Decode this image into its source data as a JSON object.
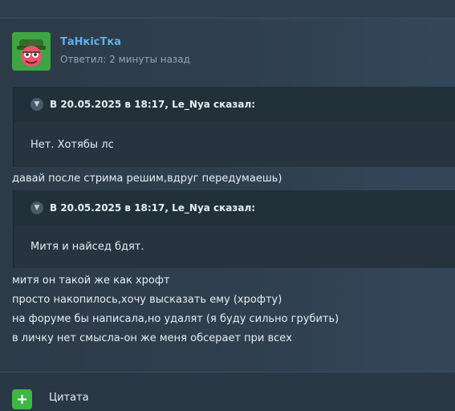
{
  "post": {
    "author": "ТаНкісТка",
    "meta": "Ответил: 2 минуты назад"
  },
  "quotes": [
    {
      "header": "В 20.05.2025 в 18:17, Le_Nya сказал:",
      "body": "Нет. Хотябы лс"
    },
    {
      "header": "В 20.05.2025 в 18:17, Le_Nya сказал:",
      "body": "Митя и найсед бдят."
    }
  ],
  "reply_line": "давай после стрима решим,вдруг передумаешь)",
  "text_lines": [
    "митя он такой же как хрофт",
    "просто накопилось,хочу высказать ему (хрофту)",
    "на форуме бы написала,но удалят (я буду сильно грубить)",
    "в личку нет смысла-он же меня обсерает при всех"
  ],
  "footer": {
    "quote_label": "Цитата"
  },
  "icons": {
    "expand": "chevron-down-icon",
    "add": "plus-icon",
    "avatar": "tank-character-avatar"
  },
  "colors": {
    "author": "#5db0ee",
    "button": "#3fb645",
    "background": "#2b3947"
  }
}
